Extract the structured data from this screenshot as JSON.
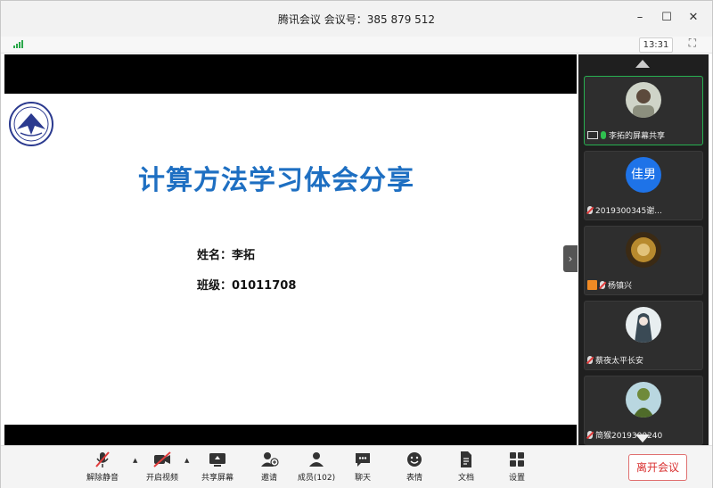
{
  "window": {
    "title": "腾讯会议 会议号：385 879 512",
    "minimize_icon": "minimize-icon",
    "maximize_icon": "maximize-icon",
    "close_icon": "close-icon"
  },
  "status": {
    "time": "13:31",
    "signal_icon": "signal-bars-icon",
    "fullscreen_icon": "fullscreen-icon"
  },
  "slide": {
    "title": "计算方法学习体会分享",
    "name_line": "姓名：李拓",
    "class_line": "班级：01011708",
    "title_color": "#1e6fc2"
  },
  "participants": [
    {
      "label": "李拓的屏幕共享",
      "avatar": "photo",
      "mic": "on",
      "active": true
    },
    {
      "label": "2019300345谢...",
      "avatar_text": "佳男",
      "mic": "muted"
    },
    {
      "label": "杨镇兴",
      "avatar": "photo",
      "mic": "muted",
      "host": true
    },
    {
      "label": "蔡夜太平长安",
      "avatar": "photo",
      "mic": "muted"
    },
    {
      "label": "简猴2019300240",
      "avatar": "photo",
      "mic": "muted"
    }
  ],
  "toolbar": {
    "unmute": "解除静音",
    "start_video": "开启视频",
    "share_screen": "共享屏幕",
    "invite": "邀请",
    "members": "成员(102)",
    "chat": "聊天",
    "reactions": "表情",
    "docs": "文档",
    "settings": "设置",
    "leave": "离开会议"
  },
  "colors": {
    "accent_green": "#27b050",
    "leave_red": "#d93030",
    "avatar_blue": "#1e73e8"
  }
}
